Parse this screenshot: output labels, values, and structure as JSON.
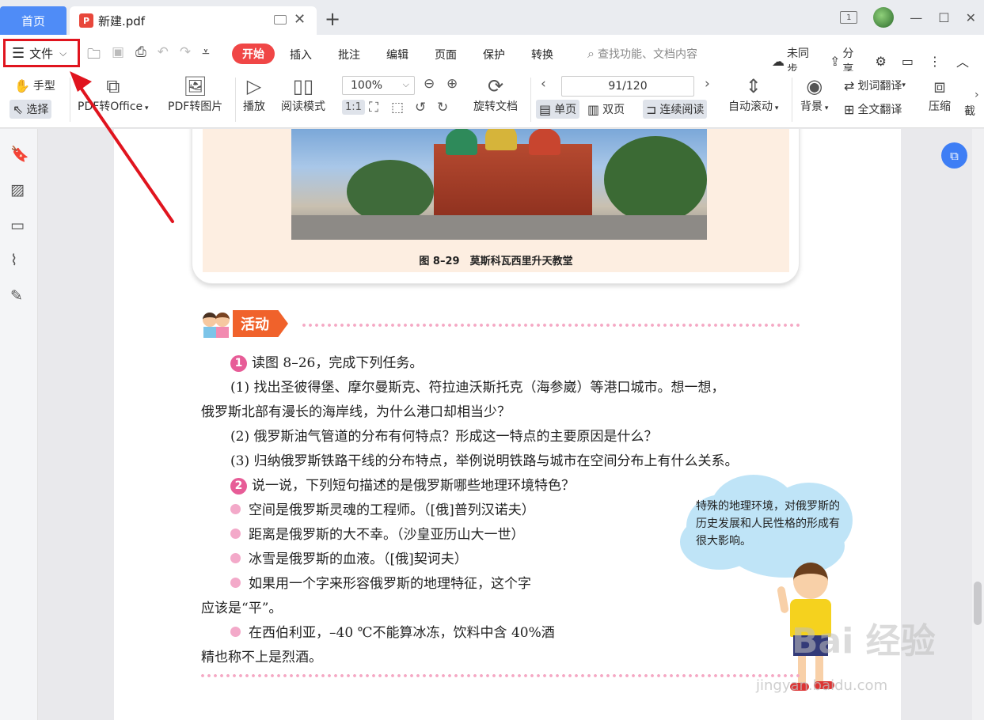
{
  "tabbar": {
    "home_label": "首页",
    "doc_badge": "P",
    "doc_title": "新建.pdf",
    "close_glyph": "✕",
    "new_tab_glyph": "+",
    "page_indicator": "1"
  },
  "menu": {
    "file_label": "文件",
    "tabs": [
      "开始",
      "插入",
      "批注",
      "编辑",
      "页面",
      "保护",
      "转换"
    ],
    "search_placeholder": "查找功能、文档内容",
    "sync_label": "未同步",
    "share_label": "分享"
  },
  "ribbon": {
    "hand_label": "手型",
    "select_label": "选择",
    "pdf_to_office": "PDF转Office",
    "pdf_to_image": "PDF转图片",
    "play_label": "播放",
    "reading_mode": "阅读模式",
    "zoom_value": "100%",
    "rotate_doc": "旋转文档",
    "page_value": "91/120",
    "single_page": "单页",
    "double_page": "双页",
    "continuous": "连续阅读",
    "auto_scroll": "自动滚动",
    "background": "背景",
    "word_translate": "划词翻译",
    "full_translate": "全文翻译",
    "compress": "压缩",
    "truncated": "截"
  },
  "document": {
    "caption": "图 8–29　莫斯科瓦西里升天教堂",
    "activity_title": "活动",
    "q1_num": "1",
    "q1_text": "读图 8–26，完成下列任务。",
    "q1_1a": "(1) 找出圣彼得堡、摩尔曼斯克、符拉迪沃斯托克（海参崴）等港口城市。想一想，",
    "q1_1b": "俄罗斯北部有漫长的海岸线，为什么港口却相当少？",
    "q1_2": "(2) 俄罗斯油气管道的分布有何特点？形成这一特点的主要原因是什么？",
    "q1_3": "(3) 归纳俄罗斯铁路干线的分布特点，举例说明铁路与城市在空间分布上有什么关系。",
    "q2_num": "2",
    "q2_text": "说一说，下列短句描述的是俄罗斯哪些地理环境特色？",
    "b1": "空间是俄罗斯灵魂的工程师。（[俄]普列汉诺夫）",
    "b2": "距离是俄罗斯的大不幸。（沙皇亚历山大一世）",
    "b3": "冰雪是俄罗斯的血液。（[俄]契诃夫）",
    "b4a": "如果用一个字来形容俄罗斯的地理特征，这个字",
    "b4b": "应该是“平”。",
    "b5a": "在西伯利亚，–40 ℃不能算冰冻，饮料中含 40%酒",
    "b5b": "精也称不上是烈酒。",
    "bubble": "特殊的地理环境，对俄罗斯的历史发展和人民性格的形成有很大影响。"
  },
  "watermark": {
    "main": "Bai 经验",
    "sub": "jingyan.baidu.com"
  },
  "colors": {
    "accent_blue": "#4f8cf7",
    "start_tab_red": "#f04646",
    "highlight_red": "#e0141e",
    "activity_orange": "#f0622b",
    "badge_pink": "#e75c97"
  }
}
